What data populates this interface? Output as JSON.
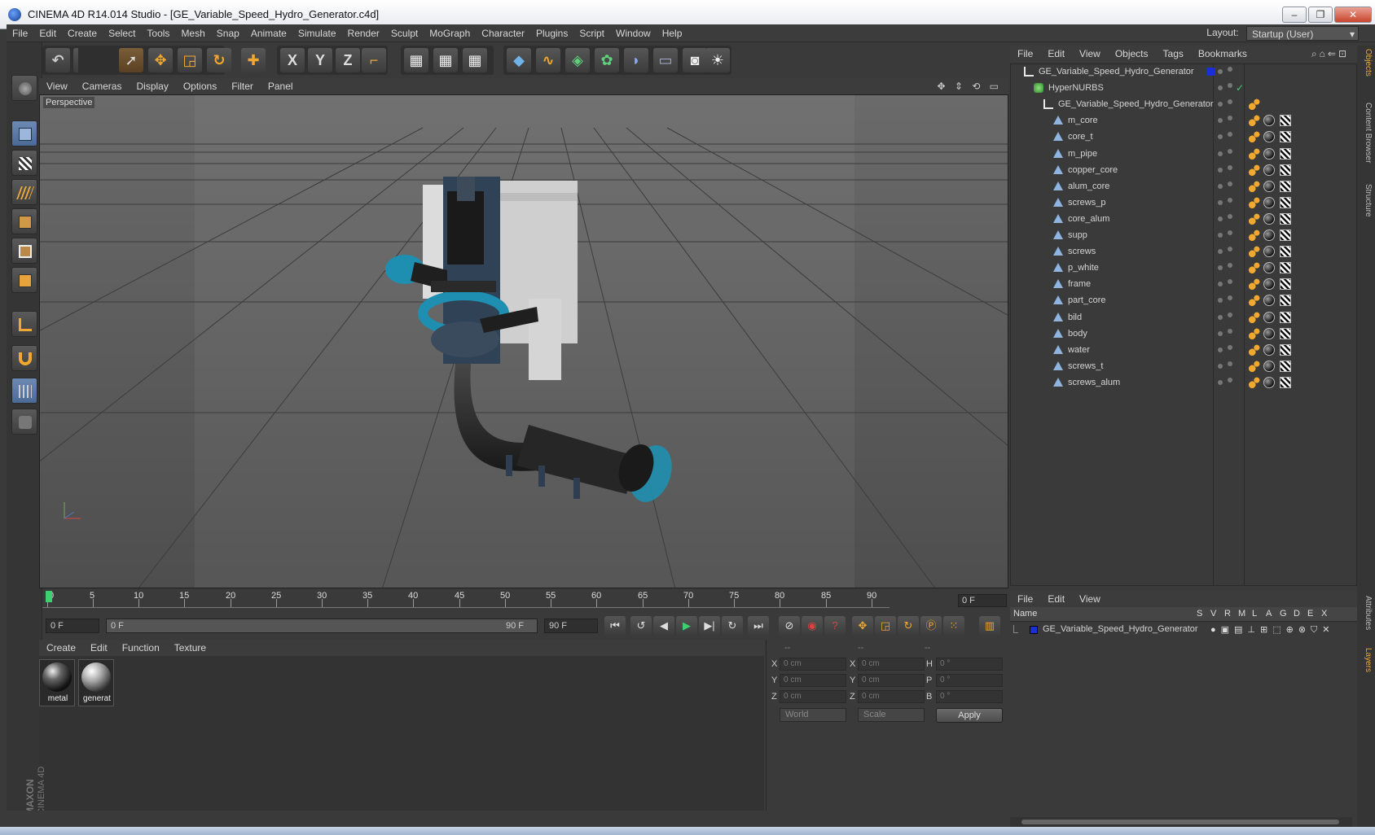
{
  "window": {
    "title": "CINEMA 4D R14.014 Studio - [GE_Variable_Speed_Hydro_Generator.c4d]",
    "minimize": "–",
    "restore": "❐",
    "close": "✕"
  },
  "menubar": [
    "File",
    "Edit",
    "Create",
    "Select",
    "Tools",
    "Mesh",
    "Snap",
    "Animate",
    "Simulate",
    "Render",
    "Sculpt",
    "MoGraph",
    "Character",
    "Plugins",
    "Script",
    "Window",
    "Help"
  ],
  "layout": {
    "label": "Layout:",
    "value": "Startup (User)"
  },
  "toolbar": {
    "x_axis": "X",
    "y_axis": "Y",
    "z_axis": "Z"
  },
  "viewport": {
    "menu": [
      "View",
      "Cameras",
      "Display",
      "Options",
      "Filter",
      "Panel"
    ],
    "camera_label": "Perspective",
    "nav_icons": "✥ ⇕ ⟲ ▭"
  },
  "timeline": {
    "ticks": [
      "0",
      "5",
      "10",
      "15",
      "20",
      "25",
      "30",
      "35",
      "40",
      "45",
      "50",
      "55",
      "60",
      "65",
      "70",
      "75",
      "80",
      "85",
      "90"
    ],
    "current_frame": "0 F",
    "start_field": "0 F",
    "range_start": "0 F",
    "range_end": "90 F",
    "end_field": "90 F"
  },
  "material_manager": {
    "menu": [
      "Create",
      "Edit",
      "Function",
      "Texture"
    ],
    "materials": [
      {
        "name": "metal"
      },
      {
        "name": "generat"
      }
    ]
  },
  "brand": {
    "maxon": "MAXON",
    "product": "CINEMA 4D"
  },
  "coordinates": {
    "headers": [
      "--",
      "--",
      "--"
    ],
    "rows": [
      {
        "a": "X",
        "a_val": "0 cm",
        "b": "X",
        "b_val": "0 cm",
        "c": "H",
        "c_val": "0 °"
      },
      {
        "a": "Y",
        "a_val": "0 cm",
        "b": "Y",
        "b_val": "0 cm",
        "c": "P",
        "c_val": "0 °"
      },
      {
        "a": "Z",
        "a_val": "0 cm",
        "b": "Z",
        "b_val": "0 cm",
        "c": "B",
        "c_val": "0 °"
      }
    ],
    "space": "World",
    "mode": "Scale",
    "apply": "Apply"
  },
  "object_manager": {
    "menu": [
      "File",
      "Edit",
      "View",
      "Objects",
      "Tags",
      "Bookmarks"
    ],
    "objects": [
      {
        "name": "GE_Variable_Speed_Hydro_Generator",
        "level": 0,
        "type": "null"
      },
      {
        "name": "HyperNURBS",
        "level": 1,
        "type": "nurbs"
      },
      {
        "name": "GE_Variable_Speed_Hydro_Generator",
        "level": 2,
        "type": "null"
      },
      {
        "name": "m_core",
        "level": 3,
        "type": "poly"
      },
      {
        "name": "core_t",
        "level": 3,
        "type": "poly"
      },
      {
        "name": "m_pipe",
        "level": 3,
        "type": "poly"
      },
      {
        "name": "copper_core",
        "level": 3,
        "type": "poly"
      },
      {
        "name": "alum_core",
        "level": 3,
        "type": "poly"
      },
      {
        "name": "screws_p",
        "level": 3,
        "type": "poly"
      },
      {
        "name": "core_alum",
        "level": 3,
        "type": "poly"
      },
      {
        "name": "supp",
        "level": 3,
        "type": "poly"
      },
      {
        "name": "screws",
        "level": 3,
        "type": "poly"
      },
      {
        "name": "p_white",
        "level": 3,
        "type": "poly"
      },
      {
        "name": "frame",
        "level": 3,
        "type": "poly"
      },
      {
        "name": "part_core",
        "level": 3,
        "type": "poly"
      },
      {
        "name": "bild",
        "level": 3,
        "type": "poly"
      },
      {
        "name": "body",
        "level": 3,
        "type": "poly"
      },
      {
        "name": "water",
        "level": 3,
        "type": "poly"
      },
      {
        "name": "screws_t",
        "level": 3,
        "type": "poly"
      },
      {
        "name": "screws_alum",
        "level": 3,
        "type": "poly"
      }
    ]
  },
  "layer_manager": {
    "menu": [
      "File",
      "Edit",
      "View"
    ],
    "columns": [
      "Name",
      "S",
      "V",
      "R",
      "M",
      "L",
      "A",
      "G",
      "D",
      "E",
      "X"
    ],
    "layers": [
      {
        "name": "GE_Variable_Speed_Hydro_Generator"
      }
    ]
  },
  "right_tabs": [
    "Objects",
    "Content Browser",
    "Structure",
    "Attributes",
    "Layers"
  ],
  "colors": {
    "accent": "#f0a830",
    "model_blue": "#1e8fb0",
    "bg": "#3a3a3a"
  }
}
